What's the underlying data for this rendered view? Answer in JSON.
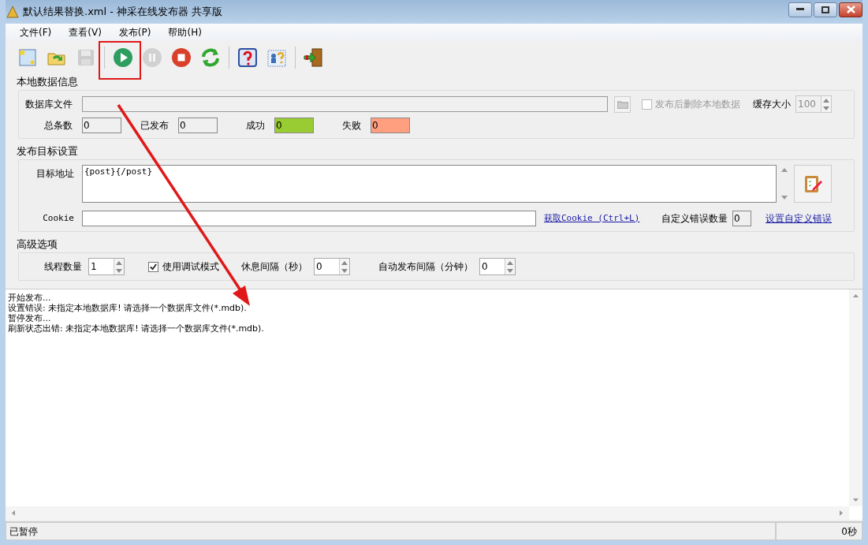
{
  "window": {
    "title": "默认结果替换.xml - 神采在线发布器 共享版"
  },
  "menu": [
    "文件(F)",
    "查看(V)",
    "发布(P)",
    "帮助(H)"
  ],
  "toolbar": [
    {
      "kind": "new",
      "disabled": false
    },
    {
      "kind": "open",
      "disabled": false
    },
    {
      "kind": "save",
      "disabled": true
    },
    {
      "kind": "separator"
    },
    {
      "kind": "play",
      "disabled": false
    },
    {
      "kind": "pause",
      "disabled": true
    },
    {
      "kind": "stop",
      "disabled": false
    },
    {
      "kind": "refresh",
      "disabled": false
    },
    {
      "kind": "separator"
    },
    {
      "kind": "help",
      "disabled": false
    },
    {
      "kind": "about",
      "disabled": false
    },
    {
      "kind": "separator"
    },
    {
      "kind": "exit",
      "disabled": false
    }
  ],
  "local_data": {
    "title": "本地数据信息",
    "db_label": "数据库文件",
    "delete_after": {
      "label": "发布后删除本地数据",
      "checked": false,
      "disabled": true
    },
    "cache": {
      "label": "缓存大小",
      "value": "100",
      "disabled": true
    },
    "stats": [
      {
        "label": "总条数",
        "value": "0",
        "color": "#f0f0f0"
      },
      {
        "label": "已发布",
        "value": "0",
        "color": "#f0f0f0"
      },
      {
        "label": "成功",
        "value": "0",
        "color": "#99cc33"
      },
      {
        "label": "失败",
        "value": "0",
        "color": "#ff9f7f"
      }
    ]
  },
  "target": {
    "title": "发布目标设置",
    "address_label": "目标地址",
    "address_value": "{post}{/post}",
    "cookie_label": "Cookie",
    "get_cookie_link": "获取Cookie (Ctrl+L)",
    "error_count_label": "自定义错误数量",
    "error_count_value": "0",
    "set_error_link": "设置自定义错误"
  },
  "advanced": {
    "title": "高级选项",
    "threads": {
      "label": "线程数量",
      "value": "1"
    },
    "debug": {
      "label": "使用调试模式",
      "checked": true
    },
    "rest": {
      "label": "休息间隔（秒）",
      "value": "0"
    },
    "auto": {
      "label": "自动发布间隔（分钟）",
      "value": "0"
    }
  },
  "log": [
    "开始发布...",
    "设置错误: 未指定本地数据库! 请选择一个数据库文件(*.mdb).",
    "暂停发布...",
    "刷新状态出错: 未指定本地数据库! 请选择一个数据库文件(*.mdb)."
  ],
  "status_bar": {
    "state": "已暂停",
    "time": "0秒"
  }
}
